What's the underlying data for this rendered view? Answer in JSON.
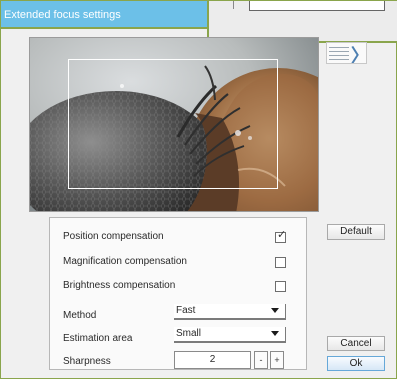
{
  "window": {
    "title": "Extended focus settings"
  },
  "options": {
    "position_compensation": {
      "label": "Position compensation",
      "checked": true,
      "check_glyph": "✓"
    },
    "magnification_compensation": {
      "label": "Magnification compensation",
      "checked": false
    },
    "brightness_compensation": {
      "label": "Brightness compensation",
      "checked": false
    }
  },
  "settings": {
    "method": {
      "label": "Method",
      "value": "Fast"
    },
    "estimation_area": {
      "label": "Estimation area",
      "value": "Small"
    },
    "sharpness": {
      "label": "Sharpness",
      "value": "2",
      "decrement": "-",
      "increment": "+"
    }
  },
  "buttons": {
    "default": "Default",
    "cancel": "Cancel",
    "ok": "Ok"
  },
  "icons": {
    "expand": "chevron-right-icon",
    "dropdown": "chevron-down-icon"
  },
  "colors": {
    "titlebar": "#6cc0e8",
    "accent_border": "#8aa54c",
    "ok_border": "#66a8d8"
  }
}
